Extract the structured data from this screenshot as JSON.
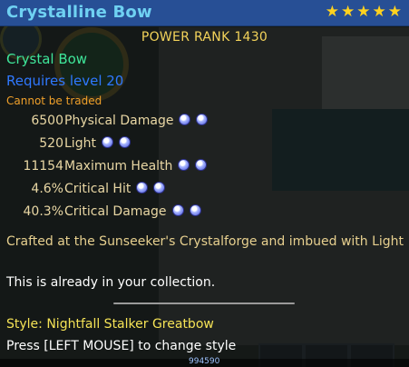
{
  "item": {
    "title": "Crystalline Bow",
    "stars": 5,
    "power_rank": "POWER RANK 1430",
    "type": "Crystal Bow",
    "requirement": "Requires level 20",
    "trade_note": "Cannot be traded"
  },
  "stats": [
    {
      "value": "6500",
      "name": "Physical Damage",
      "gems": 2
    },
    {
      "value": "520",
      "name": "Light",
      "gems": 2
    },
    {
      "value": "11154",
      "name": "Maximum Health",
      "gems": 2
    },
    {
      "value": "4.6%",
      "name": "Critical Hit",
      "gems": 2
    },
    {
      "value": "40.3%",
      "name": "Critical Damage",
      "gems": 2
    }
  ],
  "description": "Crafted at the Sunseeker's Crystalforge and imbued with Light",
  "collection_note": "This is already in your collection.",
  "style_label": "Style: Nightfall Stalker Greatbow",
  "style_hint": "Press [LEFT MOUSE] to change style",
  "background_counter": "994590",
  "colors": {
    "title_bar": "#274f95",
    "title_text": "#6fd1f2",
    "star": "#ffd21f",
    "power_rank": "#f3d35a",
    "item_type": "#3fe69a",
    "requirement": "#2f78ff",
    "trade_note": "#f0a02a",
    "stat_text": "#e9d7a4",
    "style_text": "#f5e356"
  },
  "icons": {
    "star": "star-icon",
    "gem": "gem-socket-icon"
  }
}
